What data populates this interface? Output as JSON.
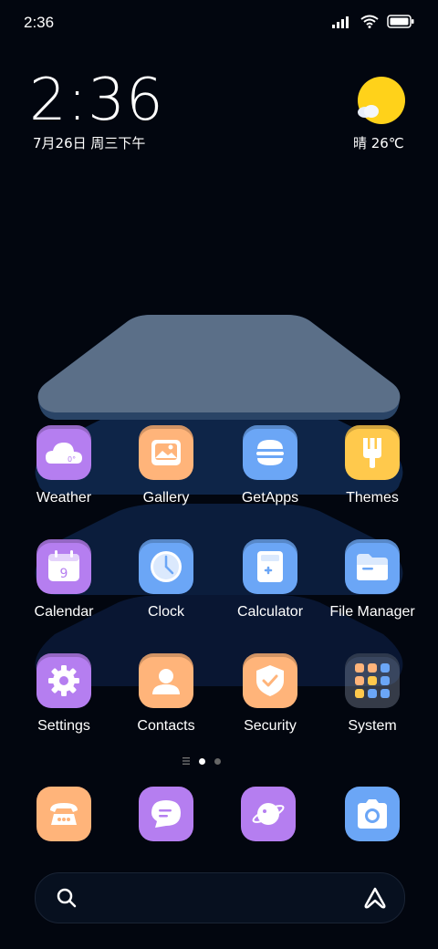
{
  "status_bar": {
    "time": "2:36"
  },
  "widget": {
    "clock": "2:36",
    "date": "7月26日 周三下午",
    "weather": "晴 26℃"
  },
  "apps": [
    {
      "label": "Weather",
      "icon": "weather-icon"
    },
    {
      "label": "Gallery",
      "icon": "gallery-icon"
    },
    {
      "label": "GetApps",
      "icon": "getapps-icon"
    },
    {
      "label": "Themes",
      "icon": "themes-icon"
    },
    {
      "label": "Calendar",
      "icon": "calendar-icon"
    },
    {
      "label": "Clock",
      "icon": "clock-icon"
    },
    {
      "label": "Calculator",
      "icon": "calculator-icon"
    },
    {
      "label": "File Manager",
      "icon": "folder-icon"
    },
    {
      "label": "Settings",
      "icon": "gear-icon"
    },
    {
      "label": "Contacts",
      "icon": "contacts-icon"
    },
    {
      "label": "Security",
      "icon": "shield-icon"
    },
    {
      "label": "System",
      "icon": "folder-grid-icon"
    }
  ],
  "weather_icon_text": "0°",
  "calendar_icon_text": "9",
  "dock": [
    "phone-icon",
    "messages-icon",
    "browser-icon",
    "camera-icon"
  ],
  "colors": {
    "purple": "#b57ef0",
    "orange": "#ffb47a",
    "blue": "#6ba6f6",
    "yellow": "#ffc94c",
    "background": "#02060f"
  }
}
